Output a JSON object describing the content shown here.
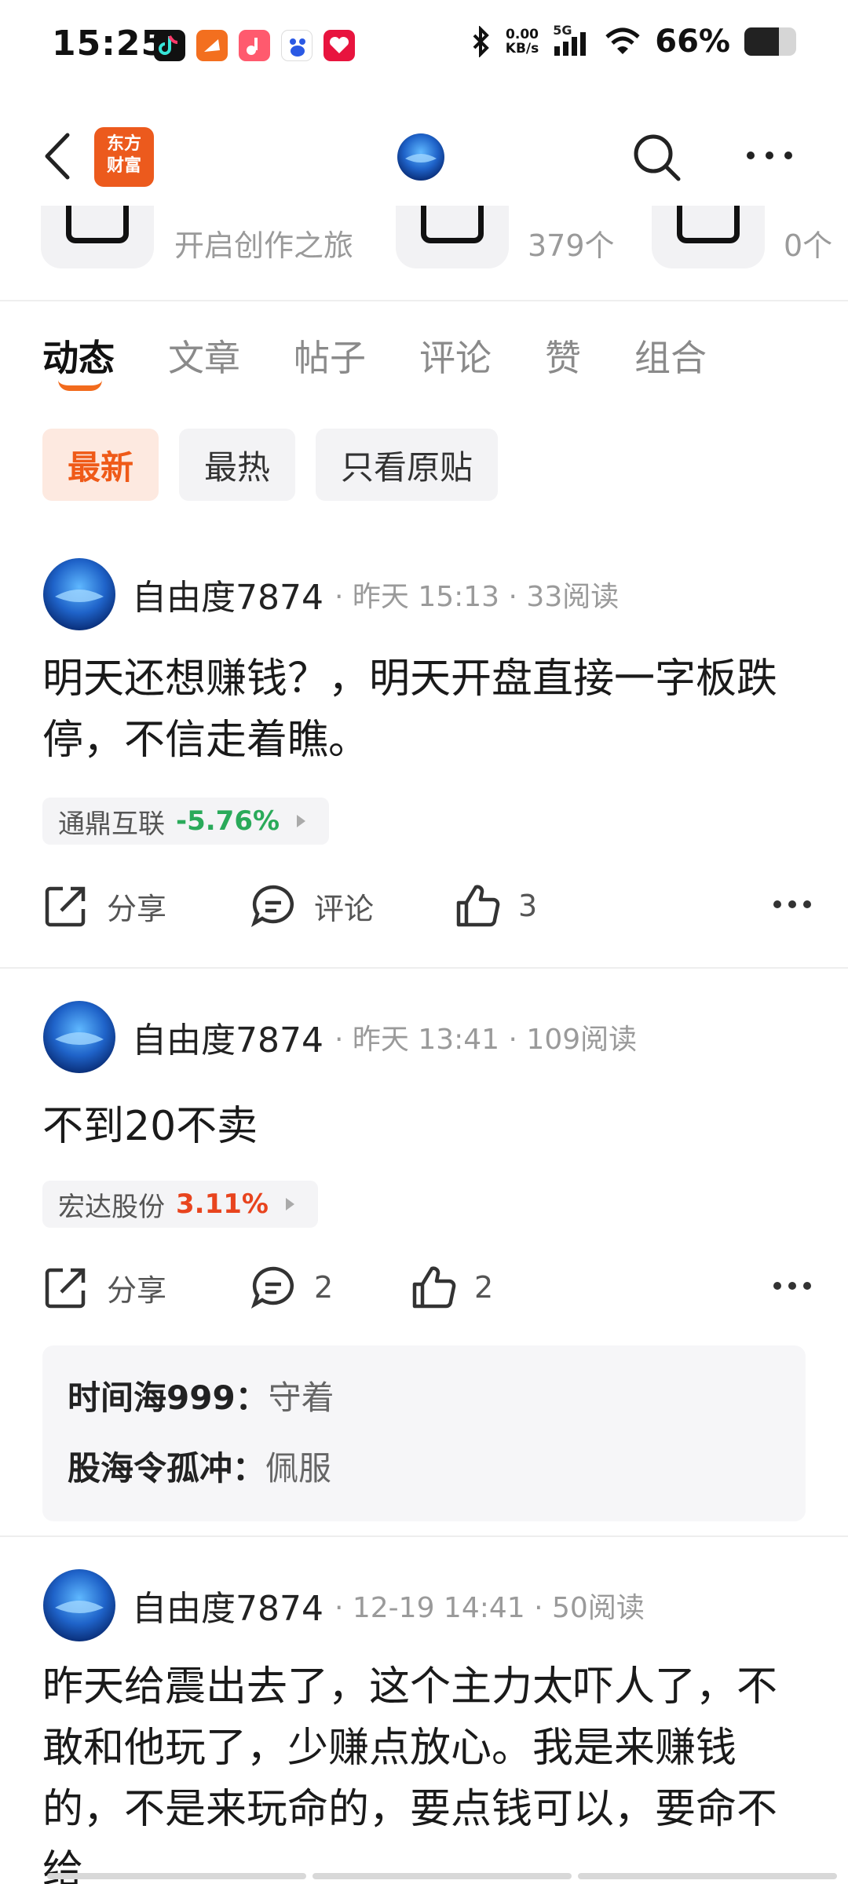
{
  "status_bar": {
    "time": "15:25",
    "net_speed_value": "0.00",
    "net_speed_unit": "KB/s",
    "network": "5G",
    "battery_percent": "66%",
    "battery_level": 0.66,
    "app_icons": [
      "douyin-icon",
      "orange-app-icon",
      "red-music-icon",
      "baidu-icon",
      "red-heart-app-icon"
    ]
  },
  "nav": {
    "brand_line1": "东方",
    "brand_line2": "财富",
    "brand_color": "#ec5a1d"
  },
  "stats": [
    {
      "label": "开启创作之旅"
    },
    {
      "label": "379个"
    },
    {
      "label": "0个"
    }
  ],
  "tabs": [
    {
      "label": "动态",
      "active": true
    },
    {
      "label": "文章"
    },
    {
      "label": "帖子"
    },
    {
      "label": "评论"
    },
    {
      "label": "赞"
    },
    {
      "label": "组合"
    }
  ],
  "filters": [
    {
      "label": "最新",
      "active": true
    },
    {
      "label": "最热"
    },
    {
      "label": "只看原贴"
    }
  ],
  "accent_color": "#f26b1d",
  "posts": [
    {
      "author": "自由度7874",
      "time": "昨天 15:13",
      "reads": "33阅读",
      "body": "明天还想赚钱？，明天开盘直接一字板跌停，不信走着瞧。",
      "stock_name": "通鼎互联",
      "stock_change": "-5.76%",
      "stock_color": "#2aaa5a",
      "share_label": "分享",
      "comment_label": "评论",
      "like_count": "3"
    },
    {
      "author": "自由度7874",
      "time": "昨天 13:41",
      "reads": "109阅读",
      "body": "不到20不卖",
      "stock_name": "宏达股份",
      "stock_change": "3.11%",
      "stock_color": "#e8441e",
      "share_label": "分享",
      "comment_label": "2",
      "like_count": "2",
      "comments": [
        {
          "name": "时间海999：",
          "text": "守着"
        },
        {
          "name": "股海令孤冲：",
          "text": "佩服"
        }
      ]
    },
    {
      "author": "自由度7874",
      "time": "12-19 14:41",
      "reads": "50阅读",
      "body": "昨天给震出去了，这个主力太吓人了，不敢和他玩了，少赚点放心。我是来赚钱的，不是来玩命的，要点钱可以，要命不给"
    }
  ]
}
